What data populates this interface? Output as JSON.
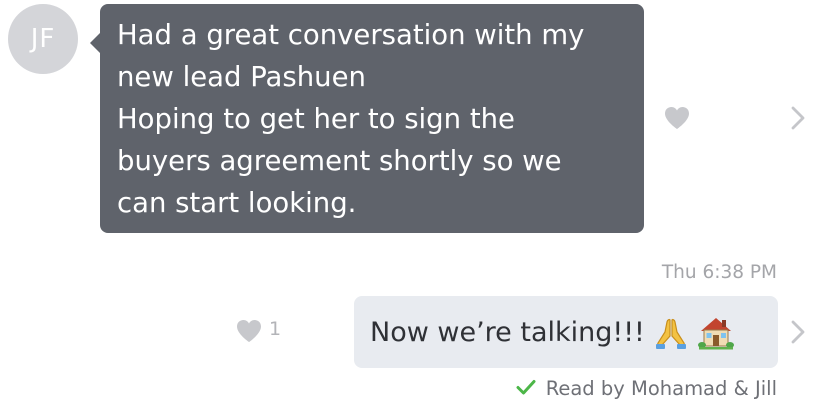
{
  "incoming_message": {
    "avatar_initials": "JF",
    "lines": [
      "Had a great conversation with my",
      "new lead Pashuen",
      "Hoping to get her to sign the",
      "buyers agreement shortly so we",
      "can start looking."
    ],
    "heart_icon": "heart-icon",
    "chevron_icon": "chevron-right-icon"
  },
  "timestamp": "Thu 6:38 PM",
  "outgoing_message": {
    "text": "Now we’re talking!!!",
    "emojis": [
      "folded-hands-emoji",
      "house-with-garden-emoji"
    ],
    "like_count": "1",
    "read_receipt": "Read by Mohamad & Jill",
    "check_icon": "checkmark-icon"
  },
  "colors": {
    "incoming_bubble": "#5f636b",
    "outgoing_bubble": "#e8ebf0",
    "avatar_bg": "#d4d5d9",
    "check_green": "#4cb648",
    "heart_gray": "#c7c8cc"
  }
}
